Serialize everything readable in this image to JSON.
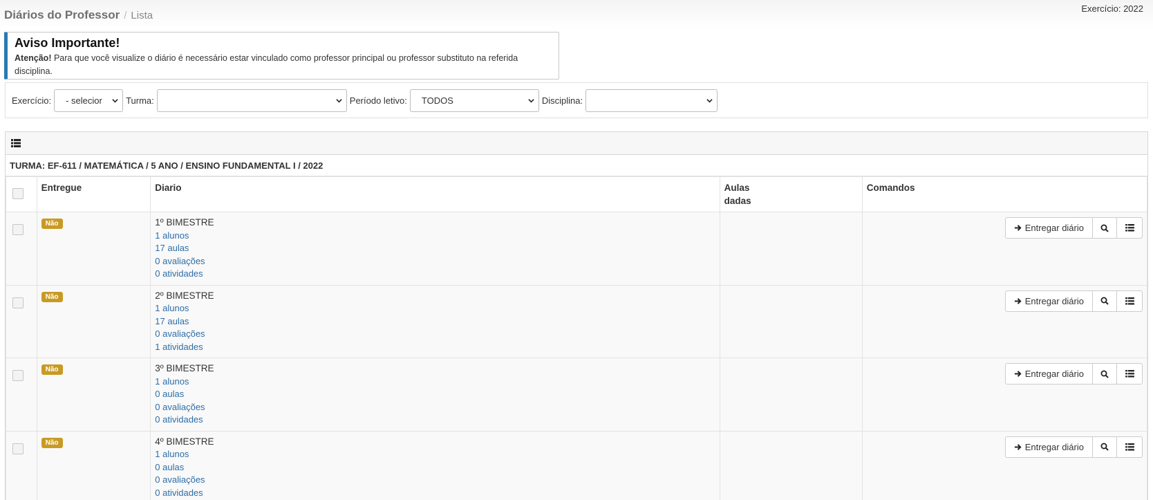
{
  "header": {
    "title": "Diários do Professor",
    "separator": "/",
    "crumb": "Lista",
    "exercicio": "Exercício: 2022"
  },
  "alert": {
    "title": "Aviso Importante!",
    "strong": "Atenção!",
    "text": " Para que você visualize o diário é necessário estar vinculado como professor principal ou professor substituto na referida disciplina."
  },
  "filters": {
    "exercicio_label": "Exercício:",
    "exercicio_value": "- selecior",
    "turma_label": "Turma:",
    "turma_value": "",
    "periodo_label": "Período letivo:",
    "periodo_value": "TODOS",
    "disciplina_label": "Disciplina:",
    "disciplina_value": ""
  },
  "table": {
    "turma": "TURMA: EF-611 / MATEMÁTICA / 5 ANO / ENSINO FUNDAMENTAL I / 2022",
    "headers": {
      "entregue": "Entregue",
      "diario": "Diario",
      "aulas_dadas_1": "Aulas",
      "aulas_dadas_2": "dadas",
      "comandos": "Comandos"
    },
    "rows": [
      {
        "entregue": "Não",
        "nome": "1º BIMESTRE",
        "alunos": "1 alunos",
        "aulas": "17 aulas",
        "avaliacoes": "0 avaliações",
        "atividades": "0 atividades",
        "aulas_dadas": "",
        "entregar": "Entregar diário"
      },
      {
        "entregue": "Não",
        "nome": "2º BIMESTRE",
        "alunos": "1 alunos",
        "aulas": "17 aulas",
        "avaliacoes": "0 avaliações",
        "atividades": "1 atividades",
        "aulas_dadas": "",
        "entregar": "Entregar diário"
      },
      {
        "entregue": "Não",
        "nome": "3º BIMESTRE",
        "alunos": "1 alunos",
        "aulas": "0 aulas",
        "avaliacoes": "0 avaliações",
        "atividades": "0 atividades",
        "aulas_dadas": "",
        "entregar": "Entregar diário"
      },
      {
        "entregue": "Não",
        "nome": "4º BIMESTRE",
        "alunos": "1 alunos",
        "aulas": "0 aulas",
        "avaliacoes": "0 avaliações",
        "atividades": "0 atividades",
        "aulas_dadas": "",
        "entregar": "Entregar diário"
      }
    ]
  },
  "icons": {
    "panel_header": "list-icon",
    "entregar": "arrow-right-icon",
    "visualizar": "search-icon",
    "detalhes": "list-icon",
    "select": "chevron-down-icon"
  },
  "colors": {
    "badge": "#c99a23",
    "link": "#2d6ea8",
    "alert_accent": "#2a7ab0"
  }
}
